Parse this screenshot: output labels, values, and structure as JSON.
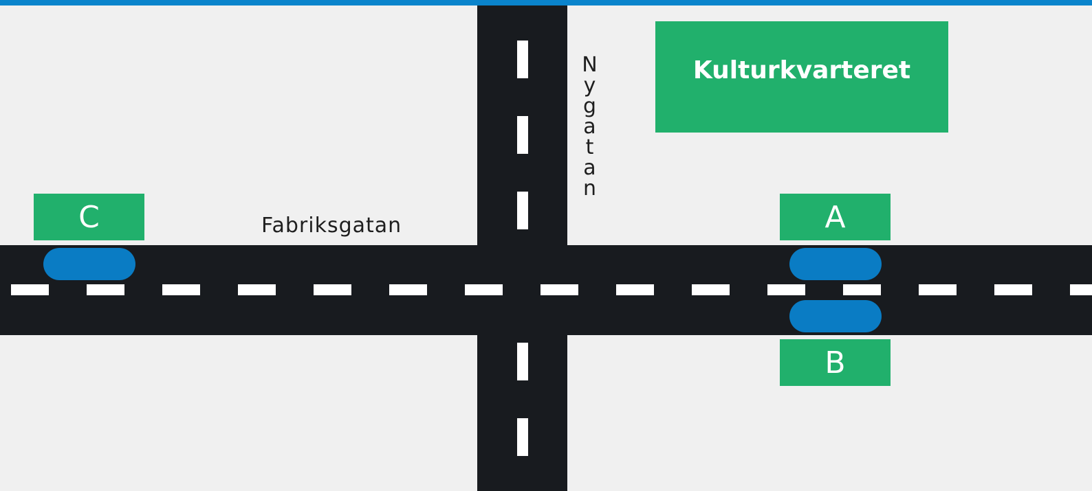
{
  "colors": {
    "accent": "#0a84cc",
    "road": "#181b1f",
    "marking": "#ffffff",
    "stop": "#21b06c",
    "bus": "#0a7cc4",
    "background": "#f0f0f0"
  },
  "streets": {
    "horizontal": "Fabriksgatan",
    "vertical": "Nygatan"
  },
  "building": {
    "label": "Kulturkvarteret"
  },
  "stops": [
    {
      "id": "C",
      "label": "C"
    },
    {
      "id": "A",
      "label": "A"
    },
    {
      "id": "B",
      "label": "B"
    }
  ]
}
